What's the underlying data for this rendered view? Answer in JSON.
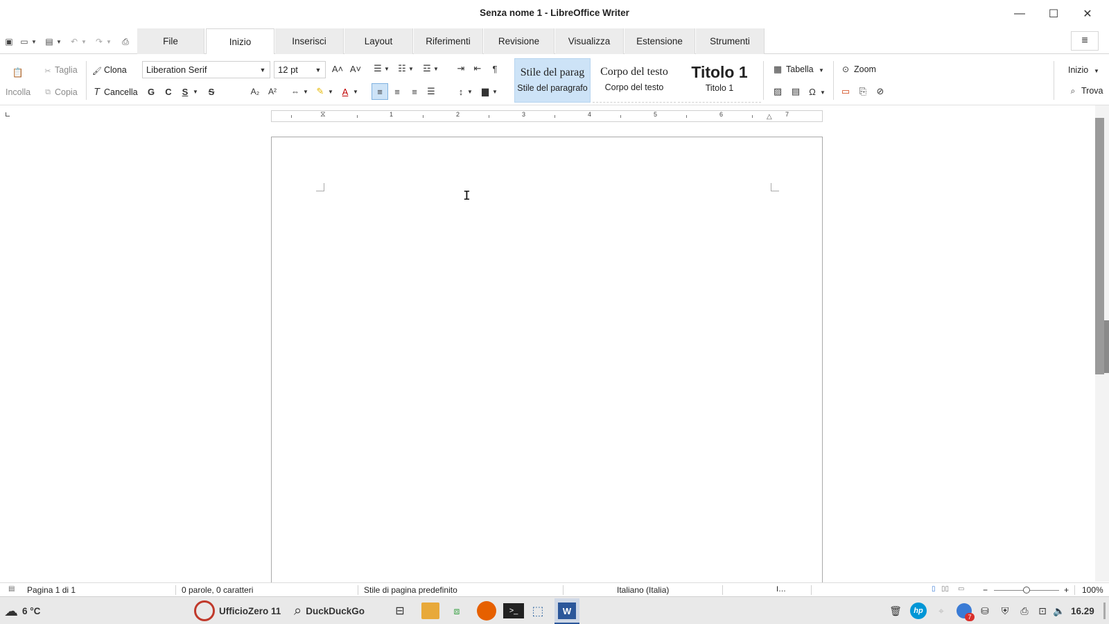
{
  "window": {
    "title": "Senza nome 1 - LibreOffice Writer",
    "minimize": "—",
    "maximize": "☐",
    "close": "✕"
  },
  "tabs": [
    {
      "label": "File"
    },
    {
      "label": "Inizio"
    },
    {
      "label": "Inserisci"
    },
    {
      "label": "Layout"
    },
    {
      "label": "Riferimenti"
    },
    {
      "label": "Revisione"
    },
    {
      "label": "Visualizza"
    },
    {
      "label": "Estensione"
    },
    {
      "label": "Strumenti"
    }
  ],
  "active_tab": "Inizio",
  "ribbon": {
    "incolla": "Incolla",
    "taglia": "Taglia",
    "copia": "Copia",
    "clona": "Clona",
    "cancella": "Cancella",
    "font_name": "Liberation Serif",
    "font_size": "12 pt",
    "bold": "G",
    "italic": "C",
    "underline": "S",
    "strike": "S",
    "styles": [
      {
        "preview": "Stile del parag",
        "label": "Stile del paragrafo"
      },
      {
        "preview": "Corpo del testo",
        "label": "Corpo del testo"
      },
      {
        "preview": "Titolo 1",
        "label": "Titolo 1"
      }
    ],
    "tabella": "Tabella",
    "zoom": "Zoom",
    "inizio": "Inizio",
    "trova": "Trova"
  },
  "ruler": {
    "numbers": [
      "1",
      "2",
      "3",
      "4",
      "5",
      "6",
      "7"
    ]
  },
  "status": {
    "page": "Pagina 1 di 1",
    "words": "0 parole, 0 caratteri",
    "page_style": "Stile di pagina predefinito",
    "language": "Italiano (Italia)",
    "zoom": "100%"
  },
  "taskbar": {
    "weather": "6 °C",
    "app1": "UfficioZero 11",
    "search": "DuckDuckGo",
    "clock": "16.29",
    "badge": "7"
  }
}
